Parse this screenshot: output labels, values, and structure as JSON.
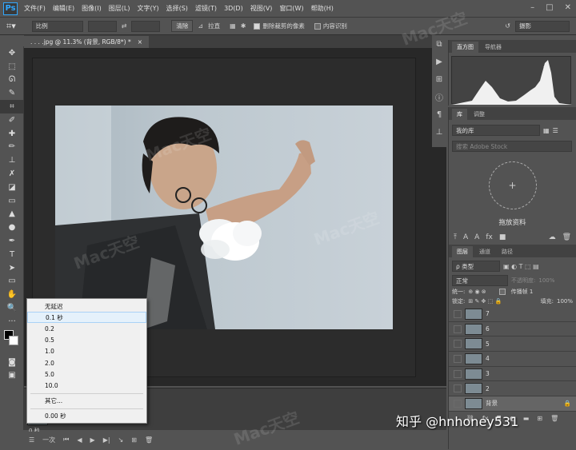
{
  "menubar": {
    "logo": "Ps",
    "items": [
      "文件(F)",
      "编辑(E)",
      "图像(I)",
      "图层(L)",
      "文字(Y)",
      "选择(S)",
      "滤镜(T)",
      "3D(D)",
      "视图(V)",
      "窗口(W)",
      "帮助(H)"
    ]
  },
  "options": {
    "ratio_label": "比例",
    "clear_label": "清除",
    "straighten_label": "拉直",
    "delete_cropped_label": "删除裁剪的像素",
    "content_aware_label": "内容识别",
    "workspace_label": "摄影"
  },
  "document": {
    "tab_title": ". . . .jpg @ 11.3% (背景, RGB/8*) *",
    "close": "×"
  },
  "panels": {
    "histogram_tabs": [
      "直方图",
      "导航器"
    ],
    "library_tabs": [
      "库",
      "调整"
    ],
    "library_name": "我的库",
    "search_placeholder": "搜索 Adobe Stock",
    "drop_text": "拖放资料",
    "layer_tabs": [
      "图层",
      "通道",
      "路径"
    ],
    "filter_label": "ρ 类型",
    "blend_mode": "正常",
    "opacity_label": "不透明度:",
    "opacity_value": "100%",
    "unify_label": "统一:",
    "propagate_label": "传播帧 1",
    "lock_label": "锁定:",
    "fill_label": "填充:",
    "fill_value": "100%",
    "layers": [
      "7",
      "6",
      "5",
      "4",
      "3",
      "2",
      "背景"
    ]
  },
  "popup": {
    "items": [
      "无延迟",
      "0.1 秒",
      "0.2",
      "0.5",
      "1.0",
      "2.0",
      "5.0",
      "10.0"
    ],
    "other": "其它...",
    "current": "0.00 秒"
  },
  "timeline": {
    "delay_label": "0 秒",
    "loop_label": "一次"
  },
  "credit": "知乎 @hnhoney531",
  "watermark": "Mac天空"
}
